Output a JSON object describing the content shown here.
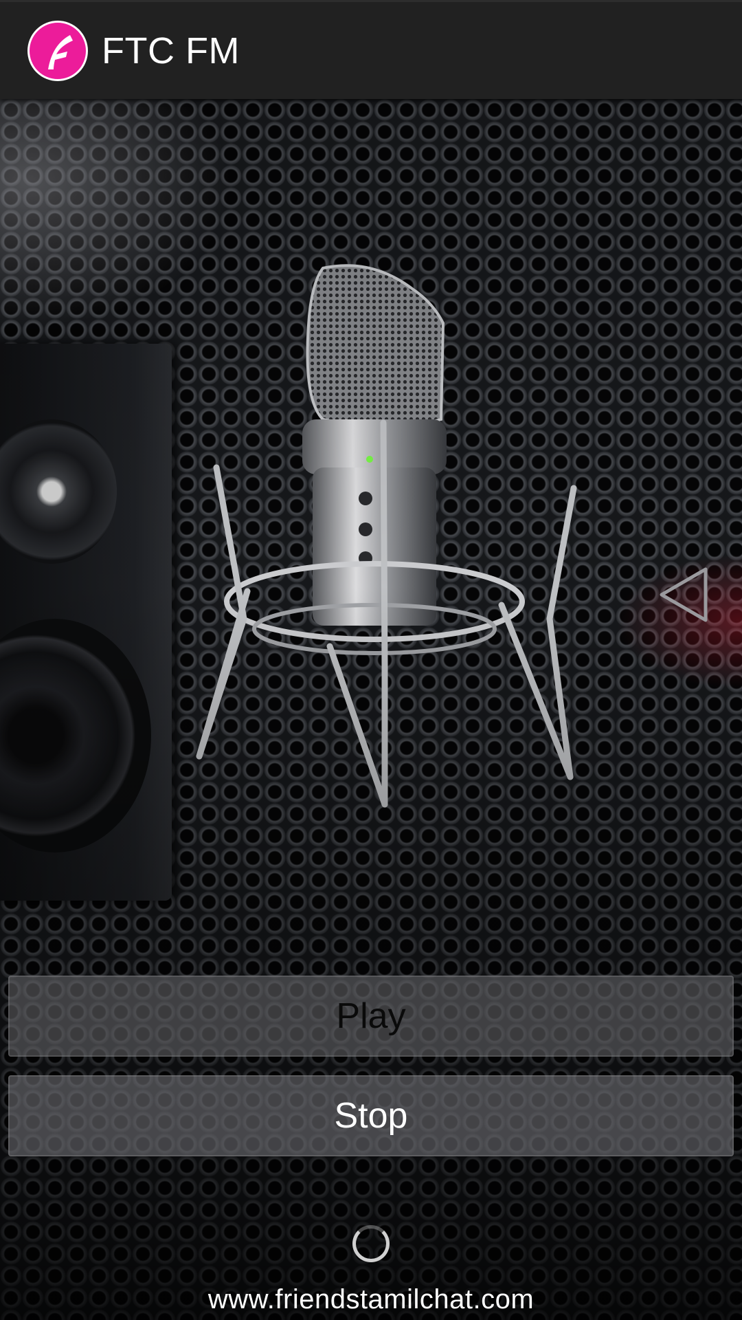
{
  "app_bar": {
    "title": "FTC FM",
    "logo_icon": "ftc-f-logo-icon",
    "logo_color": "#ec1c9a",
    "background": "#212121"
  },
  "background": {
    "description_icon": "microphone-speaker-grille-background"
  },
  "side_tab": {
    "icon": "triangle-left-icon"
  },
  "controls": {
    "play_label": "Play",
    "stop_label": "Stop"
  },
  "loading": {
    "icon": "loading-spinner-icon"
  },
  "footer": {
    "url": "www.friendstamilchat.com"
  }
}
